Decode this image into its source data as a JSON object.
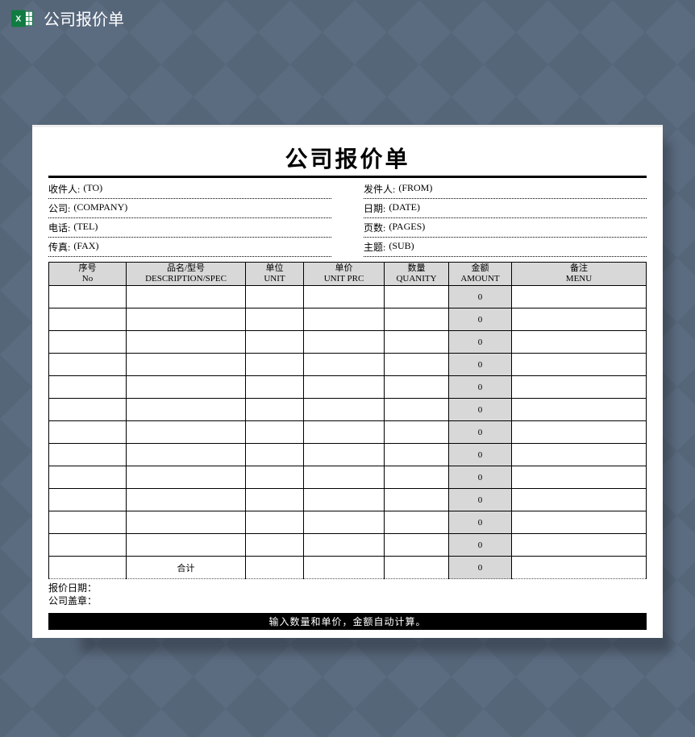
{
  "header": {
    "app_title": "公司报价单"
  },
  "doc": {
    "title": "公司报价单",
    "info_left": [
      {
        "label": "收件人:",
        "value": "(TO)"
      },
      {
        "label": "公司:",
        "value": "(COMPANY)"
      },
      {
        "label": "电话:",
        "value": " (TEL)"
      },
      {
        "label": "传真:",
        "value": "(FAX)"
      }
    ],
    "info_right": [
      {
        "label": "发件人:",
        "value": "(FROM)"
      },
      {
        "label": "日期:",
        "value": " (DATE)"
      },
      {
        "label": "页数:",
        "value": " (PAGES)"
      },
      {
        "label": "主题:",
        "value": " (SUB)"
      }
    ],
    "columns": [
      {
        "l1": "序号",
        "l2": "No"
      },
      {
        "l1": "品名/型号",
        "l2": "DESCRIPTION/SPEC"
      },
      {
        "l1": "单位",
        "l2": "UNIT"
      },
      {
        "l1": "单价",
        "l2": "UNIT PRC"
      },
      {
        "l1": "数量",
        "l2": "QUANITY"
      },
      {
        "l1": "金额",
        "l2": "AMOUNT"
      },
      {
        "l1": "备注",
        "l2": "MENU"
      }
    ],
    "rows": [
      {
        "no": "",
        "desc": "",
        "unit": "",
        "uprc": "",
        "qty": "",
        "amt": "0",
        "menu": ""
      },
      {
        "no": "",
        "desc": "",
        "unit": "",
        "uprc": "",
        "qty": "",
        "amt": "0",
        "menu": ""
      },
      {
        "no": "",
        "desc": "",
        "unit": "",
        "uprc": "",
        "qty": "",
        "amt": "0",
        "menu": ""
      },
      {
        "no": "",
        "desc": "",
        "unit": "",
        "uprc": "",
        "qty": "",
        "amt": "0",
        "menu": ""
      },
      {
        "no": "",
        "desc": "",
        "unit": "",
        "uprc": "",
        "qty": "",
        "amt": "0",
        "menu": ""
      },
      {
        "no": "",
        "desc": "",
        "unit": "",
        "uprc": "",
        "qty": "",
        "amt": "0",
        "menu": ""
      },
      {
        "no": "",
        "desc": "",
        "unit": "",
        "uprc": "",
        "qty": "",
        "amt": "0",
        "menu": ""
      },
      {
        "no": "",
        "desc": "",
        "unit": "",
        "uprc": "",
        "qty": "",
        "amt": "0",
        "menu": ""
      },
      {
        "no": "",
        "desc": "",
        "unit": "",
        "uprc": "",
        "qty": "",
        "amt": "0",
        "menu": ""
      },
      {
        "no": "",
        "desc": "",
        "unit": "",
        "uprc": "",
        "qty": "",
        "amt": "0",
        "menu": ""
      },
      {
        "no": "",
        "desc": "",
        "unit": "",
        "uprc": "",
        "qty": "",
        "amt": "0",
        "menu": ""
      },
      {
        "no": "",
        "desc": "",
        "unit": "",
        "uprc": "",
        "qty": "",
        "amt": "0",
        "menu": ""
      }
    ],
    "sum_label": "合计",
    "sum_amount": "0",
    "footer1": "报价日期：",
    "footer2": "公司盖章：",
    "footer_bar": "输入数量和单价，金额自动计算。"
  }
}
